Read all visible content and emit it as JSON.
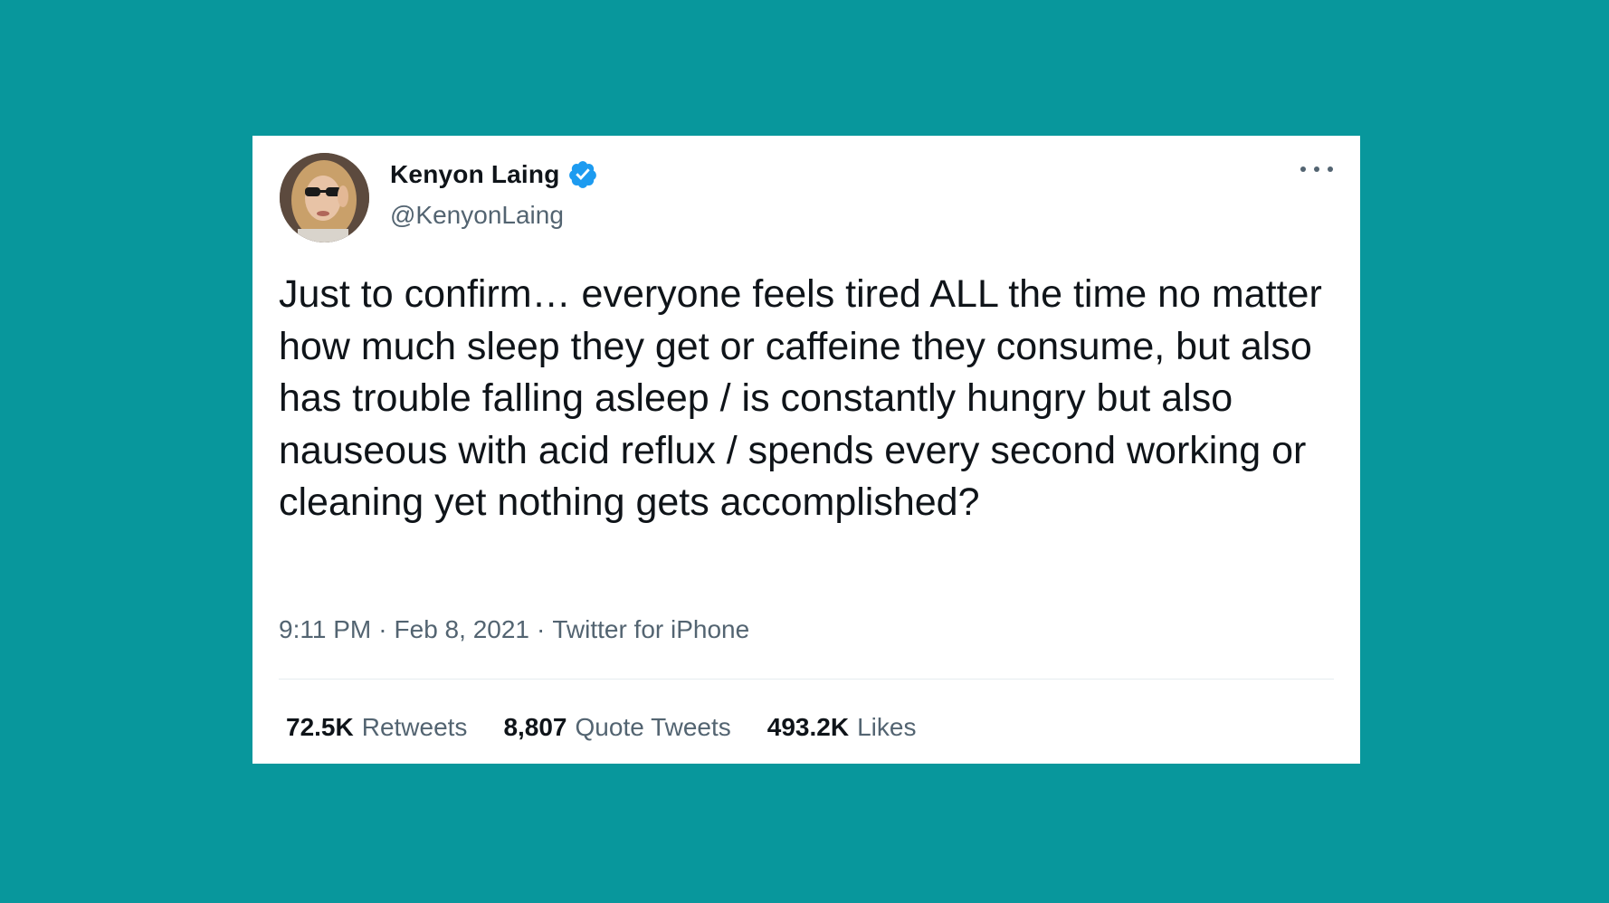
{
  "theme": {
    "background": "#08979c",
    "card": "#ffffff",
    "verified": "#1d9bf0",
    "text": "#0f1419",
    "muted": "#536471"
  },
  "author": {
    "display_name": "Kenyon Laing",
    "handle": "@KenyonLaing",
    "verified": true,
    "avatar_icon": "profile-photo"
  },
  "tweet": {
    "text": "Just to confirm… everyone feels tired ALL the time no matter how much sleep they get or caffeine they consume, but also has trouble falling asleep / is constantly hungry but also nauseous with acid reflux / spends every second working or cleaning yet nothing gets accomplished?",
    "time": "9:11 PM",
    "separator": "·",
    "date": "Feb 8, 2021",
    "source": "Twitter for iPhone"
  },
  "stats": {
    "retweets_count": "72.5K",
    "retweets_label": "Retweets",
    "quotes_count": "8,807",
    "quotes_label": "Quote Tweets",
    "likes_count": "493.2K",
    "likes_label": "Likes"
  },
  "more_icon": "more-horizontal-icon"
}
